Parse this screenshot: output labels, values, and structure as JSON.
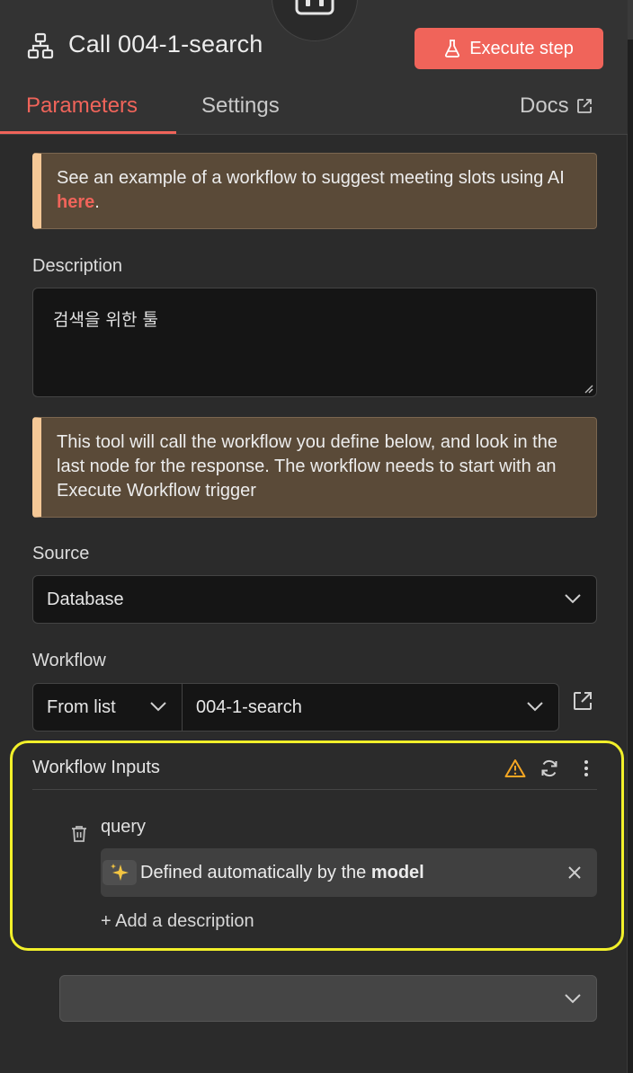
{
  "header": {
    "title": "Call 004-1-search",
    "execute_label": "Execute step",
    "tabs": [
      {
        "label": "Parameters",
        "active": true
      },
      {
        "label": "Settings",
        "active": false
      }
    ],
    "docs_label": "Docs"
  },
  "callout_example": {
    "text_before": "See an example of a workflow to suggest meeting slots using AI ",
    "link_text": "here",
    "text_after": "."
  },
  "description": {
    "label": "Description",
    "value": "검색을 위한 툴"
  },
  "callout_tool": {
    "text": "This tool will call the workflow you define below, and look in the last node for the response. The workflow needs to start with an Execute Workflow trigger"
  },
  "source": {
    "label": "Source",
    "value": "Database"
  },
  "workflow": {
    "label": "Workflow",
    "mode_value": "From list",
    "selected_value": "004-1-search"
  },
  "workflow_inputs": {
    "title": "Workflow Inputs",
    "items": [
      {
        "name": "query",
        "auto_text": "Defined automatically by the ",
        "auto_bold": "model"
      }
    ],
    "add_description": "+ Add a description"
  },
  "colors": {
    "accent": "#f0645a",
    "highlight_border": "#f2f02a",
    "warning": "#f5a623",
    "callout_bg": "#5a4a38",
    "callout_bar": "#f5c896"
  }
}
